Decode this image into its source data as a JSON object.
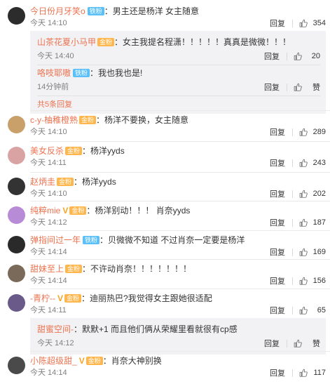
{
  "labels": {
    "reply": "回复"
  },
  "comments": [
    {
      "user": "今日份月牙笑o",
      "badges": [
        "铁粉"
      ],
      "sep": "：",
      "text": "男主还是杨洋 女主随意",
      "time": "今天 14:10",
      "likes": "354",
      "avatar_color": "#2c2c2c",
      "replies": [
        {
          "user": "山茶花夏小马甲",
          "badges": [
            "金粉"
          ],
          "sep": "：",
          "text": "女主我提名程潇！！！！！真真是微微！！！",
          "time": "今天 14:40",
          "likes": "20"
        },
        {
          "user": "咯吱耶嗷",
          "badges": [
            "铁粉"
          ],
          "sep": "：",
          "text": "我也我也是!",
          "time": "14分钟前",
          "likes": "赞"
        }
      ],
      "more": "共5条回复"
    },
    {
      "user": "c-y-柚稚橙熟",
      "badges": [
        "金粉"
      ],
      "sep": "：",
      "text": "杨洋不要换，女主随意",
      "time": "今天 14:10",
      "likes": "289",
      "avatar_color": "#c9a06a"
    },
    {
      "user": "美女反杀",
      "badges": [
        "金粉"
      ],
      "sep": "：",
      "text": "杨洋yyds",
      "time": "今天 14:11",
      "likes": "243",
      "avatar_color": "#d9a3a3"
    },
    {
      "user": "赵炳圭",
      "badges": [
        "金粉"
      ],
      "sep": "：",
      "text": "杨洋yyds",
      "time": "今天 14:10",
      "likes": "202",
      "avatar_color": "#333333"
    },
    {
      "user": "纯粹mie",
      "badges": [
        "V",
        "金粉"
      ],
      "sep": "：",
      "text": "杨洋别动！！！ 肖奈yyds",
      "time": "今天 14:12",
      "likes": "187",
      "avatar_color": "#b88bd6"
    },
    {
      "user": "弹指间过一年",
      "badges": [
        "铁粉"
      ],
      "sep": "：",
      "text": "贝微微不知道 不过肖奈一定要是杨洋",
      "time": "今天 14:14",
      "likes": "169",
      "avatar_color": "#2a2a2a"
    },
    {
      "user": "甜妹至上",
      "badges": [
        "金粉"
      ],
      "sep": "：",
      "text": "不许动肖奈！！！！！！！",
      "time": "今天 14:14",
      "likes": "156",
      "avatar_color": "#7a6a5a"
    },
    {
      "user": "-青柠--",
      "badges": [
        "V",
        "金粉"
      ],
      "sep": "：",
      "text": "迪丽热巴?我觉得女主跟她很适配",
      "time": "今天 14:11",
      "likes": "65",
      "avatar_color": "#6a5a8a",
      "replies": [
        {
          "user": "甜蜜空间-",
          "badges": [],
          "sep": "：",
          "text": "默默+1 而且他们俩从荣耀里看就很有cp感",
          "time": "今天 14:12",
          "likes": "赞"
        }
      ]
    },
    {
      "user": "小陈超级甜_",
      "badges": [
        "V",
        "金粉"
      ],
      "sep": "：",
      "text": "肖奈大神别换",
      "time": "今天 14:14",
      "likes": "117",
      "avatar_color": "#4a4a4a"
    }
  ]
}
